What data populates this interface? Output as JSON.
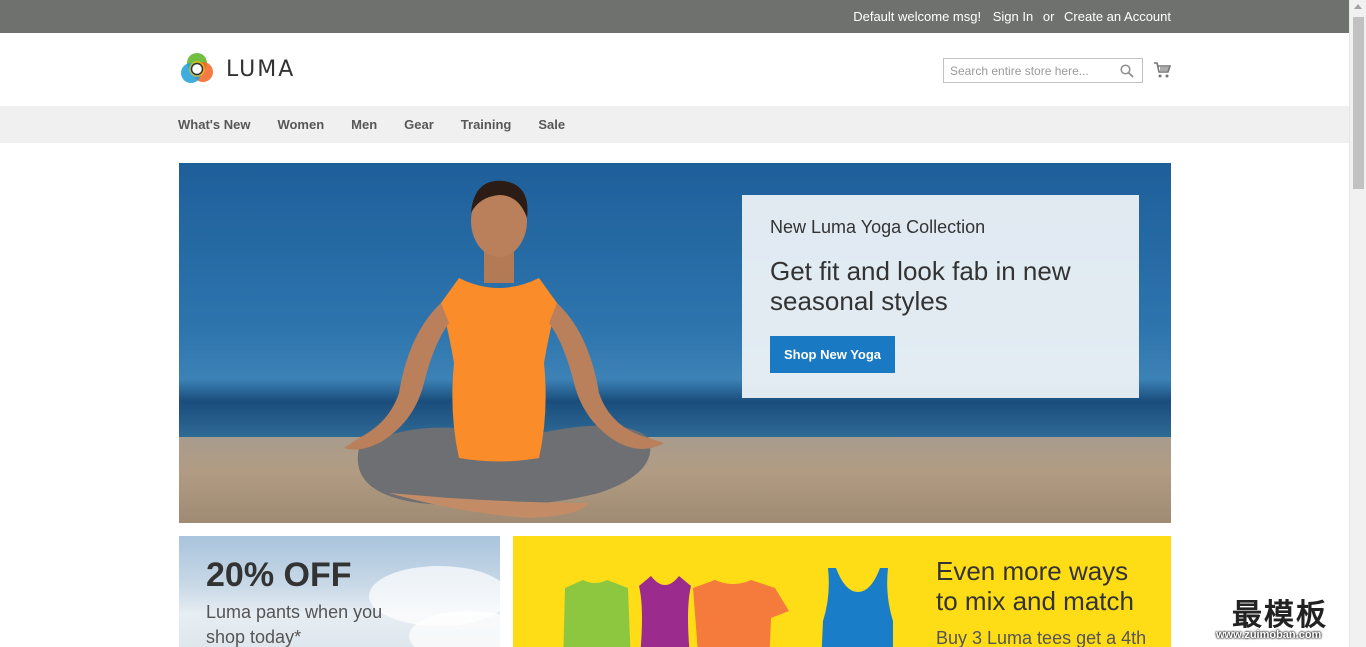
{
  "top_panel": {
    "welcome": "Default welcome msg!",
    "sign_in": "Sign In",
    "or": "or",
    "create_account": "Create an Account"
  },
  "header": {
    "logo_text": "LUMA",
    "search_placeholder": "Search entire store here...",
    "search_icon": "search-icon",
    "cart_icon": "cart-icon"
  },
  "nav": {
    "items": [
      {
        "label": "What's New"
      },
      {
        "label": "Women"
      },
      {
        "label": "Men"
      },
      {
        "label": "Gear"
      },
      {
        "label": "Training"
      },
      {
        "label": "Sale"
      }
    ]
  },
  "hero": {
    "kicker": "New Luma Yoga Collection",
    "title": "Get fit and look fab in new seasonal styles",
    "button": "Shop New Yoga"
  },
  "promo_left": {
    "title": "20% OFF",
    "text": "Luma pants when you shop today*"
  },
  "promo_right": {
    "title": "Even more ways to mix and match",
    "text": "Buy 3 Luma tees get a 4th"
  },
  "watermark": {
    "cn": "最模板",
    "url": "www.zuimoban.com"
  },
  "colors": {
    "top_panel": "#6e716e",
    "nav_bg": "#f0f0f0",
    "primary_button": "#1979c3",
    "promo_yellow": "#ffdd16"
  }
}
